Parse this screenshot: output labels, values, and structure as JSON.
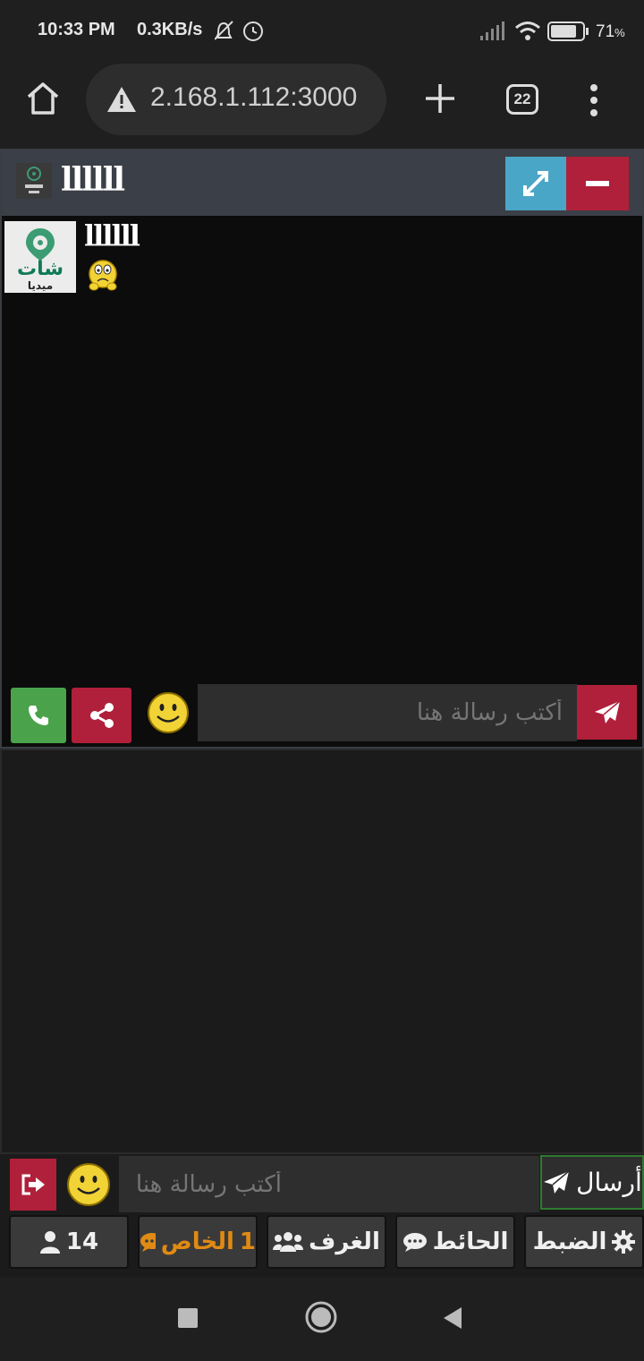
{
  "status_bar": {
    "time": "10:33 PM",
    "net_speed": "0.3KB/s",
    "battery_pct": "71",
    "battery_unit": "%"
  },
  "browser": {
    "url": "2.168.1.112:3000",
    "tab_count": "22",
    "icons": [
      "home-icon",
      "warning-icon",
      "plus-icon",
      "tabs-icon",
      "more-vert-icon"
    ]
  },
  "private_chat": {
    "title": "llllll",
    "message": {
      "sender": "llllll",
      "emoji": "worried-emoji"
    },
    "input_placeholder": "أكتب رسالة هنا",
    "colors": {
      "expand": "#4aa6c6",
      "minimize": "#b0203a",
      "call": "#4aa34a",
      "share": "#b0203a",
      "send": "#b0203a"
    }
  },
  "main_chat": {
    "input_placeholder": "أكتب رسالة هنا",
    "send_label": "أرسال"
  },
  "nav": {
    "users_count": "14",
    "private_label": "الخاص",
    "private_count": "1",
    "rooms_label": "الغرف",
    "wall_label": "الحائط",
    "settings_label": "الضبط",
    "private_color": "#e08a14"
  },
  "avatar_text": {
    "line1": "شات",
    "line2": "ميديا"
  }
}
